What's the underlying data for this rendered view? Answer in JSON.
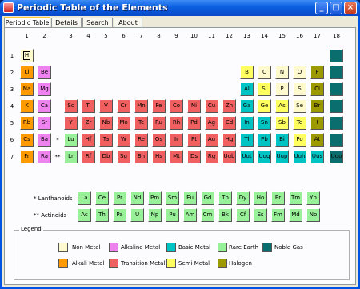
{
  "window": {
    "title": "Periodic Table of the Elements"
  },
  "tabs": [
    "Periodic Table",
    "Details",
    "Search",
    "About"
  ],
  "groups": [
    "1",
    "2",
    "3",
    "4",
    "5",
    "6",
    "7",
    "8",
    "9",
    "10",
    "11",
    "12",
    "13",
    "14",
    "15",
    "16",
    "17",
    "18"
  ],
  "periods": [
    "1",
    "2",
    "3",
    "4",
    "5",
    "6",
    "7"
  ],
  "colors": {
    "nonmetal": "#fffacd",
    "alkaline": "#ee82ee",
    "basic": "#00c4c4",
    "rare": "#98f198",
    "noble": "#0b6e6e",
    "alkali": "#ff9a00",
    "transition": "#f06060",
    "semi": "#ffff60",
    "halogen": "#9c9a00"
  },
  "elements": [
    {
      "s": "H",
      "r": 1,
      "c": 1,
      "t": "nonmetal"
    },
    {
      "s": "",
      "r": 1,
      "c": 18,
      "t": "noble"
    },
    {
      "s": "Li",
      "r": 2,
      "c": 1,
      "t": "alkali"
    },
    {
      "s": "Be",
      "r": 2,
      "c": 2,
      "t": "alkaline"
    },
    {
      "s": "B",
      "r": 2,
      "c": 13,
      "t": "semi"
    },
    {
      "s": "C",
      "r": 2,
      "c": 14,
      "t": "nonmetal"
    },
    {
      "s": "N",
      "r": 2,
      "c": 15,
      "t": "nonmetal"
    },
    {
      "s": "O",
      "r": 2,
      "c": 16,
      "t": "nonmetal"
    },
    {
      "s": "F",
      "r": 2,
      "c": 17,
      "t": "halogen"
    },
    {
      "s": "",
      "r": 2,
      "c": 18,
      "t": "noble"
    },
    {
      "s": "Na",
      "r": 3,
      "c": 1,
      "t": "alkali"
    },
    {
      "s": "Mg",
      "r": 3,
      "c": 2,
      "t": "alkaline"
    },
    {
      "s": "Al",
      "r": 3,
      "c": 13,
      "t": "basic"
    },
    {
      "s": "Si",
      "r": 3,
      "c": 14,
      "t": "semi"
    },
    {
      "s": "P",
      "r": 3,
      "c": 15,
      "t": "nonmetal"
    },
    {
      "s": "S",
      "r": 3,
      "c": 16,
      "t": "nonmetal"
    },
    {
      "s": "Cl",
      "r": 3,
      "c": 17,
      "t": "halogen"
    },
    {
      "s": "",
      "r": 3,
      "c": 18,
      "t": "noble"
    },
    {
      "s": "K",
      "r": 4,
      "c": 1,
      "t": "alkali"
    },
    {
      "s": "Ca",
      "r": 4,
      "c": 2,
      "t": "alkaline"
    },
    {
      "s": "Sc",
      "r": 4,
      "c": 3,
      "t": "transition"
    },
    {
      "s": "Ti",
      "r": 4,
      "c": 4,
      "t": "transition"
    },
    {
      "s": "V",
      "r": 4,
      "c": 5,
      "t": "transition"
    },
    {
      "s": "Cr",
      "r": 4,
      "c": 6,
      "t": "transition"
    },
    {
      "s": "Mn",
      "r": 4,
      "c": 7,
      "t": "transition"
    },
    {
      "s": "Fe",
      "r": 4,
      "c": 8,
      "t": "transition"
    },
    {
      "s": "Co",
      "r": 4,
      "c": 9,
      "t": "transition"
    },
    {
      "s": "Ni",
      "r": 4,
      "c": 10,
      "t": "transition"
    },
    {
      "s": "Cu",
      "r": 4,
      "c": 11,
      "t": "transition"
    },
    {
      "s": "Zn",
      "r": 4,
      "c": 12,
      "t": "transition"
    },
    {
      "s": "Ga",
      "r": 4,
      "c": 13,
      "t": "basic"
    },
    {
      "s": "Ge",
      "r": 4,
      "c": 14,
      "t": "semi"
    },
    {
      "s": "As",
      "r": 4,
      "c": 15,
      "t": "semi"
    },
    {
      "s": "Se",
      "r": 4,
      "c": 16,
      "t": "nonmetal"
    },
    {
      "s": "Br",
      "r": 4,
      "c": 17,
      "t": "halogen"
    },
    {
      "s": "",
      "r": 4,
      "c": 18,
      "t": "noble"
    },
    {
      "s": "Rb",
      "r": 5,
      "c": 1,
      "t": "alkali"
    },
    {
      "s": "Sr",
      "r": 5,
      "c": 2,
      "t": "alkaline"
    },
    {
      "s": "Y",
      "r": 5,
      "c": 3,
      "t": "transition"
    },
    {
      "s": "Zr",
      "r": 5,
      "c": 4,
      "t": "transition"
    },
    {
      "s": "Nb",
      "r": 5,
      "c": 5,
      "t": "transition"
    },
    {
      "s": "Mo",
      "r": 5,
      "c": 6,
      "t": "transition"
    },
    {
      "s": "Tc",
      "r": 5,
      "c": 7,
      "t": "transition"
    },
    {
      "s": "Ru",
      "r": 5,
      "c": 8,
      "t": "transition"
    },
    {
      "s": "Rh",
      "r": 5,
      "c": 9,
      "t": "transition"
    },
    {
      "s": "Pd",
      "r": 5,
      "c": 10,
      "t": "transition"
    },
    {
      "s": "Ag",
      "r": 5,
      "c": 11,
      "t": "transition"
    },
    {
      "s": "Cd",
      "r": 5,
      "c": 12,
      "t": "transition"
    },
    {
      "s": "In",
      "r": 5,
      "c": 13,
      "t": "basic"
    },
    {
      "s": "Sn",
      "r": 5,
      "c": 14,
      "t": "basic"
    },
    {
      "s": "Sb",
      "r": 5,
      "c": 15,
      "t": "semi"
    },
    {
      "s": "Te",
      "r": 5,
      "c": 16,
      "t": "semi"
    },
    {
      "s": "I",
      "r": 5,
      "c": 17,
      "t": "halogen"
    },
    {
      "s": "",
      "r": 5,
      "c": 18,
      "t": "noble"
    },
    {
      "s": "Cs",
      "r": 6,
      "c": 1,
      "t": "alkali"
    },
    {
      "s": "Ba",
      "r": 6,
      "c": 2,
      "t": "alkaline"
    },
    {
      "s": "Lu",
      "r": 6,
      "c": 3,
      "t": "rare"
    },
    {
      "s": "Hf",
      "r": 6,
      "c": 4,
      "t": "transition"
    },
    {
      "s": "Ta",
      "r": 6,
      "c": 5,
      "t": "transition"
    },
    {
      "s": "W",
      "r": 6,
      "c": 6,
      "t": "transition"
    },
    {
      "s": "Re",
      "r": 6,
      "c": 7,
      "t": "transition"
    },
    {
      "s": "Os",
      "r": 6,
      "c": 8,
      "t": "transition"
    },
    {
      "s": "Ir",
      "r": 6,
      "c": 9,
      "t": "transition"
    },
    {
      "s": "Pt",
      "r": 6,
      "c": 10,
      "t": "transition"
    },
    {
      "s": "Au",
      "r": 6,
      "c": 11,
      "t": "transition"
    },
    {
      "s": "Hg",
      "r": 6,
      "c": 12,
      "t": "transition"
    },
    {
      "s": "Tl",
      "r": 6,
      "c": 13,
      "t": "basic"
    },
    {
      "s": "Pb",
      "r": 6,
      "c": 14,
      "t": "basic"
    },
    {
      "s": "Bi",
      "r": 6,
      "c": 15,
      "t": "basic"
    },
    {
      "s": "Po",
      "r": 6,
      "c": 16,
      "t": "semi"
    },
    {
      "s": "At",
      "r": 6,
      "c": 17,
      "t": "halogen"
    },
    {
      "s": "",
      "r": 6,
      "c": 18,
      "t": "noble"
    },
    {
      "s": "Fr",
      "r": 7,
      "c": 1,
      "t": "alkali"
    },
    {
      "s": "Ra",
      "r": 7,
      "c": 2,
      "t": "alkaline"
    },
    {
      "s": "Lr",
      "r": 7,
      "c": 3,
      "t": "rare"
    },
    {
      "s": "Rf",
      "r": 7,
      "c": 4,
      "t": "transition"
    },
    {
      "s": "Db",
      "r": 7,
      "c": 5,
      "t": "transition"
    },
    {
      "s": "Sg",
      "r": 7,
      "c": 6,
      "t": "transition"
    },
    {
      "s": "Bh",
      "r": 7,
      "c": 7,
      "t": "transition"
    },
    {
      "s": "Hs",
      "r": 7,
      "c": 8,
      "t": "transition"
    },
    {
      "s": "Mt",
      "r": 7,
      "c": 9,
      "t": "transition"
    },
    {
      "s": "Ds",
      "r": 7,
      "c": 10,
      "t": "transition"
    },
    {
      "s": "Rg",
      "r": 7,
      "c": 11,
      "t": "transition"
    },
    {
      "s": "Uub",
      "r": 7,
      "c": 12,
      "t": "transition"
    },
    {
      "s": "Uut",
      "r": 7,
      "c": 13,
      "t": "basic"
    },
    {
      "s": "Uuq",
      "r": 7,
      "c": 14,
      "t": "basic"
    },
    {
      "s": "Uup",
      "r": 7,
      "c": 15,
      "t": "basic"
    },
    {
      "s": "Uuh",
      "r": 7,
      "c": 16,
      "t": "basic"
    },
    {
      "s": "Uus",
      "r": 7,
      "c": 17,
      "t": "basic"
    },
    {
      "s": "Uuo",
      "r": 7,
      "c": 18,
      "t": "noble"
    }
  ],
  "row_markers": {
    "r6": "*",
    "r7": "**"
  },
  "series": {
    "lanthanides_label": "* Lanthanoids",
    "actinides_label": "** Actinoids",
    "lanthanides": [
      "La",
      "Ce",
      "Pr",
      "Nd",
      "Pm",
      "Sm",
      "Eu",
      "Gd",
      "Tb",
      "Dy",
      "Ho",
      "Er",
      "Tm",
      "Yb"
    ],
    "actinides": [
      "Ac",
      "Th",
      "Pa",
      "U",
      "Np",
      "Pu",
      "Am",
      "Cm",
      "Bk",
      "Cf",
      "Es",
      "Fm",
      "Md",
      "No"
    ]
  },
  "legend": {
    "title": "Legend",
    "items": [
      {
        "label": "Non Metal",
        "t": "nonmetal"
      },
      {
        "label": "Alkaline Metal",
        "t": "alkaline"
      },
      {
        "label": "Basic Metal",
        "t": "basic"
      },
      {
        "label": "Rare Earth",
        "t": "rare"
      },
      {
        "label": "Noble Gas",
        "t": "noble"
      },
      {
        "label": "Alkali Metal",
        "t": "alkali"
      },
      {
        "label": "Transition Metal",
        "t": "transition"
      },
      {
        "label": "Semi Metal",
        "t": "semi"
      },
      {
        "label": "Halogen",
        "t": "halogen"
      }
    ]
  }
}
